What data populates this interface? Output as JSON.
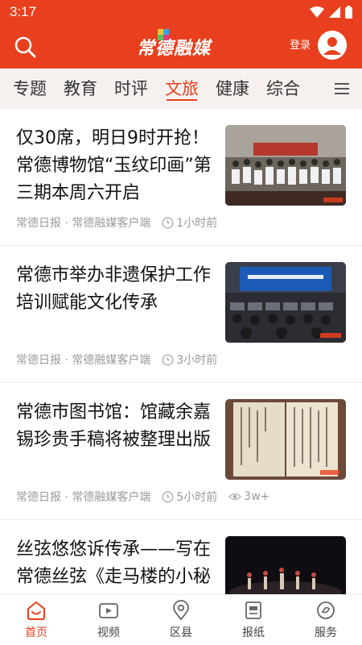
{
  "status_bar": {
    "time": "3:17"
  },
  "header": {
    "logo_text": "常德融媒",
    "login_label": "登录",
    "brand_color": "#e8401e"
  },
  "tabs": [
    {
      "label": "专题",
      "active": false
    },
    {
      "label": "教育",
      "active": false
    },
    {
      "label": "时评",
      "active": false
    },
    {
      "label": "文旅",
      "active": true
    },
    {
      "label": "健康",
      "active": false
    },
    {
      "label": "综合",
      "active": false
    }
  ],
  "news": [
    {
      "title": "仅30席，明日9时开抢！常德博物馆“玉纹印画”第三期本周六开启",
      "source": "常德日报 · 常德融媒客户端",
      "time": "1小时前",
      "views": "",
      "image_icon": "group-photo-thumbnail"
    },
    {
      "title": "常德市举办非遗保护工作培训赋能文化传承",
      "source": "常德日报 · 常德融媒客户端",
      "time": "3小时前",
      "views": "",
      "image_icon": "conference-room-thumbnail"
    },
    {
      "title": "常德市图书馆：馆藏余嘉锡珍贵手稿将被整理出版",
      "source": "常德日报 · 常德融媒客户端",
      "time": "5小时前",
      "views": "3w+",
      "image_icon": "manuscript-thumbnail"
    },
    {
      "title": "丝弦悠悠诉传承——写在常德丝弦《走马楼的小秘",
      "source": "",
      "time": "",
      "views": "",
      "image_icon": "stage-performance-thumbnail"
    }
  ],
  "bottom_nav": [
    {
      "label": "首页",
      "icon": "home-icon",
      "active": true
    },
    {
      "label": "视频",
      "icon": "video-icon",
      "active": false
    },
    {
      "label": "区县",
      "icon": "location-icon",
      "active": false
    },
    {
      "label": "报纸",
      "icon": "newspaper-icon",
      "active": false
    },
    {
      "label": "服务",
      "icon": "service-icon",
      "active": false
    }
  ]
}
